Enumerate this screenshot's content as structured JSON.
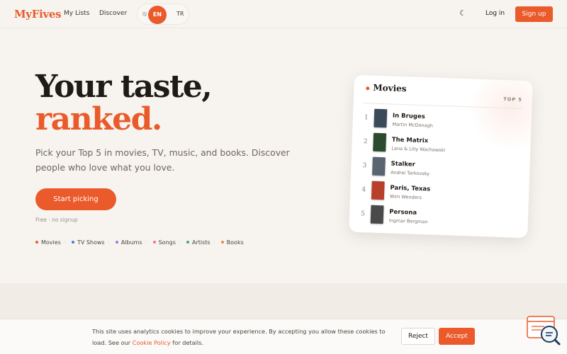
{
  "header": {
    "logo": "MyFives",
    "nav": [
      "My Lists",
      "Discover"
    ],
    "lang_icon": "globe-off-icon",
    "lang_active": "EN",
    "lang_other": "TR",
    "theme_icon": "moon-icon",
    "login": "Log in",
    "signup": "Sign up"
  },
  "hero": {
    "title_line1": "Your taste,",
    "title_line2": "ranked.",
    "subtitle": "Pick your Top 5 in movies, TV, music, and books. Discover people who love what you love.",
    "cta": "Start picking",
    "note": "Free · no signup",
    "categories": [
      {
        "label": "Movies",
        "color": "#ea5a2a"
      },
      {
        "label": "TV Shows",
        "color": "#4a7bd8"
      },
      {
        "label": "Albums",
        "color": "#9a7ad8"
      },
      {
        "label": "Songs",
        "color": "#e07a8a"
      },
      {
        "label": "Artists",
        "color": "#3aa87a"
      },
      {
        "label": "Books",
        "color": "#e08a4a"
      }
    ]
  },
  "card": {
    "title": "Movies",
    "badge": "TOP 5",
    "items": [
      {
        "rank": "1",
        "title": "In Bruges",
        "creator": "Martin McDonagh",
        "poster_color": "#3a4a5a"
      },
      {
        "rank": "2",
        "title": "The Matrix",
        "creator": "Lana & Lilly Wachowski",
        "poster_color": "#2c4a2e"
      },
      {
        "rank": "3",
        "title": "Stalker",
        "creator": "Andrei Tarkovsky",
        "poster_color": "#5a6470"
      },
      {
        "rank": "4",
        "title": "Paris, Texas",
        "creator": "Wim Wenders",
        "poster_color": "#b8402a"
      },
      {
        "rank": "5",
        "title": "Persona",
        "creator": "Ingmar Bergman",
        "poster_color": "#4a4a4a"
      }
    ]
  },
  "cookie": {
    "text_before": "This site uses analytics cookies to improve your experience. By accepting you allow these cookies to load. See our ",
    "link": "Cookie Policy",
    "text_after": " for details.",
    "reject": "Reject",
    "accept": "Accept"
  },
  "colors": {
    "accent": "#ea5a2a",
    "background": "#f7f4f0"
  }
}
